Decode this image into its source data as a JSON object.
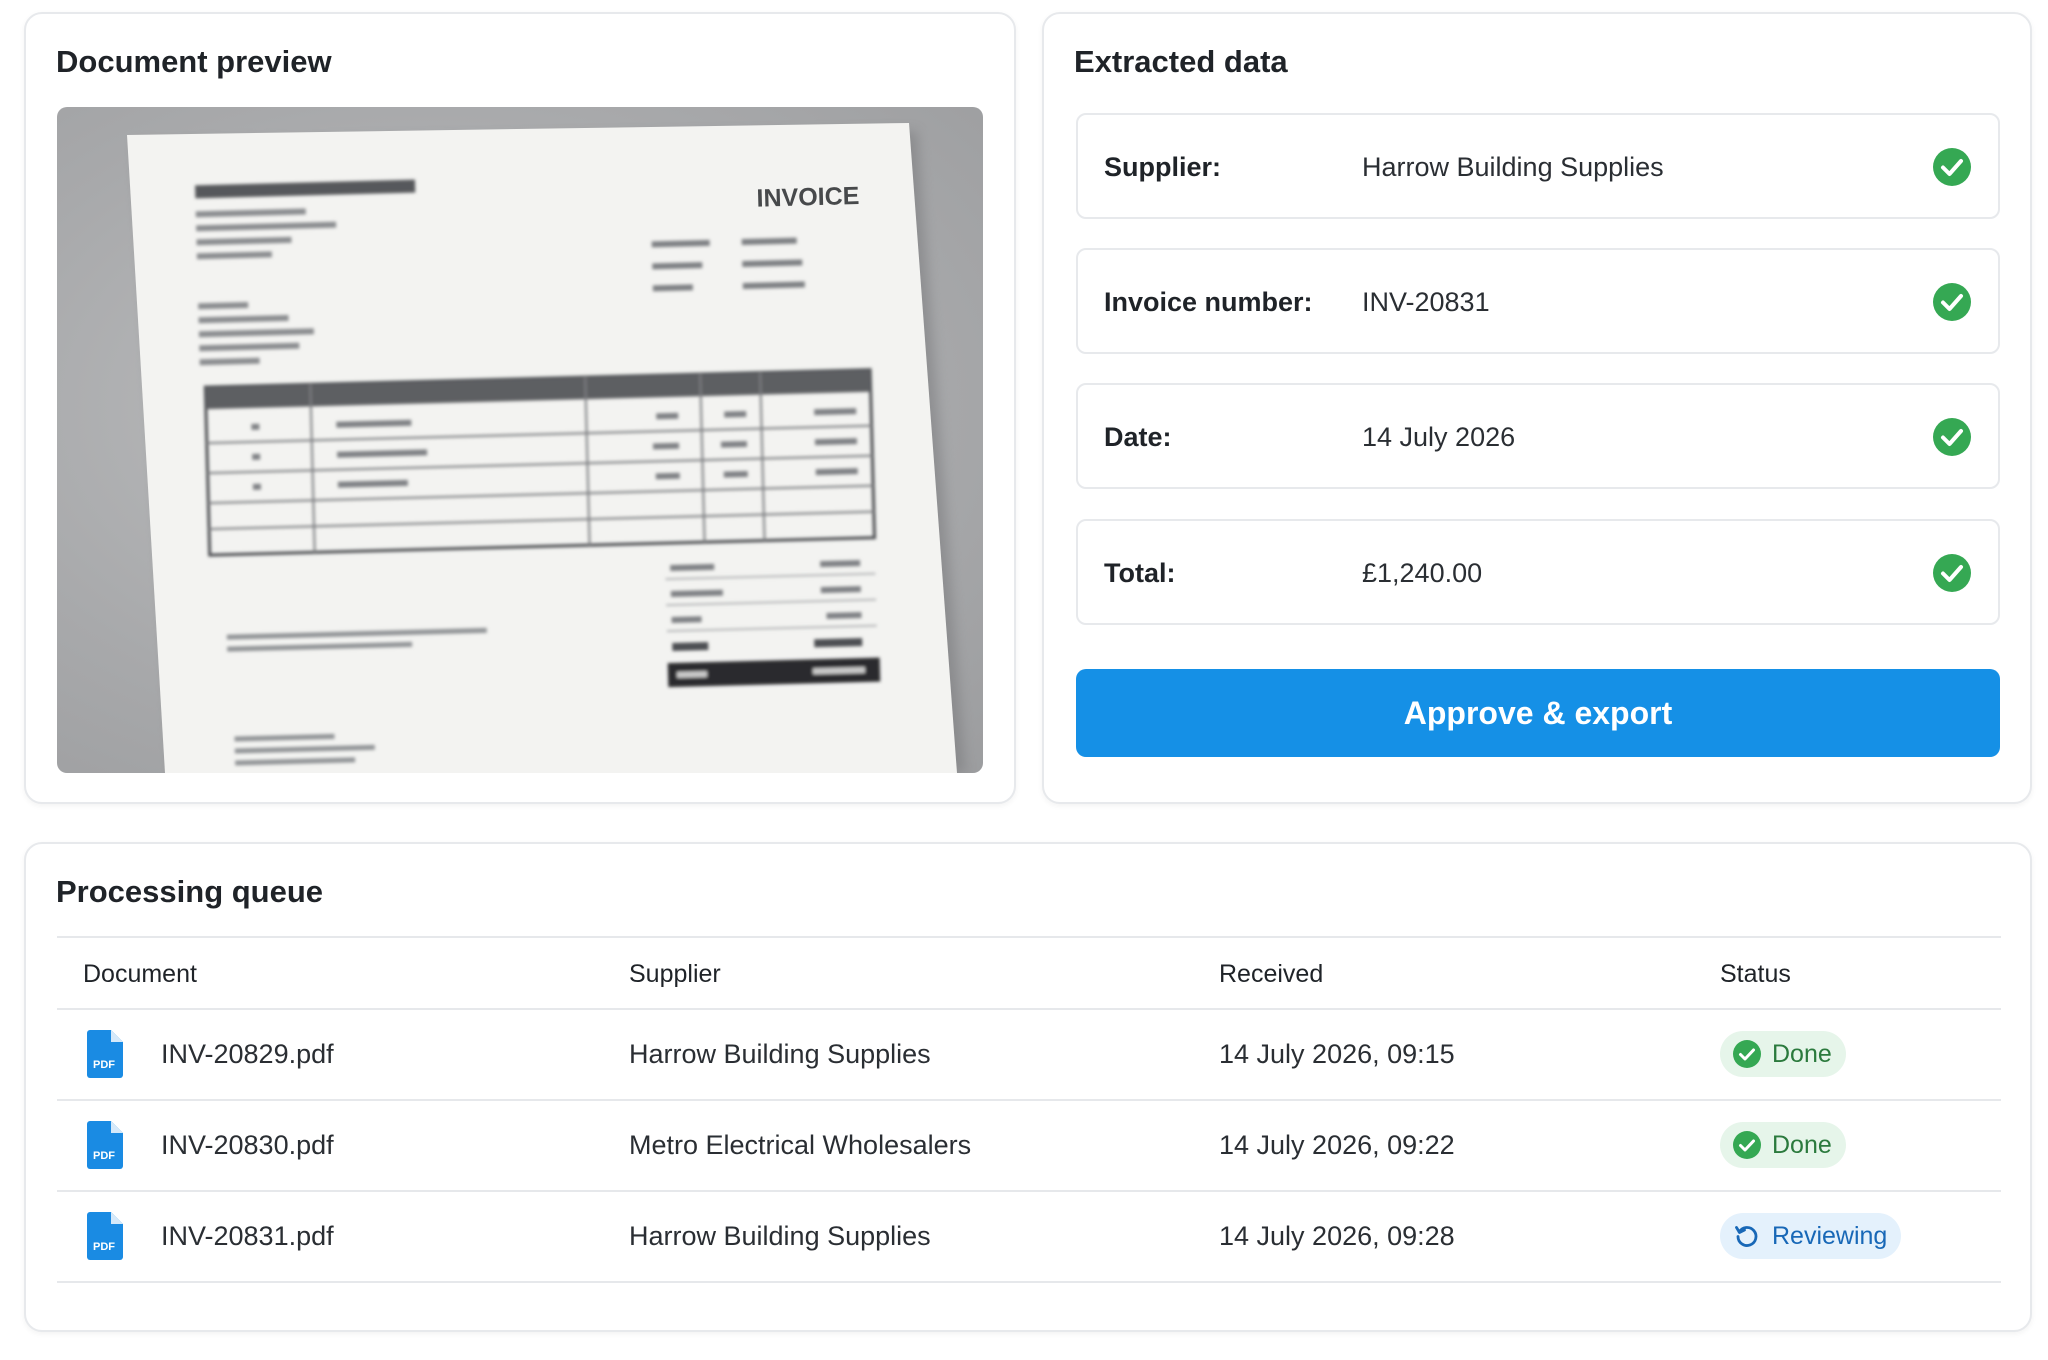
{
  "preview": {
    "title": "Document preview",
    "invoice_heading": "INVOICE"
  },
  "extracted": {
    "title": "Extracted data",
    "fields": [
      {
        "label": "Supplier:",
        "value": "Harrow Building Supplies",
        "verified": true
      },
      {
        "label": "Invoice number:",
        "value": "INV-20831",
        "verified": true
      },
      {
        "label": "Date:",
        "value": "14 July 2026",
        "verified": true
      },
      {
        "label": "Total:",
        "value": "£1,240.00",
        "verified": true
      }
    ],
    "approve_label": "Approve & export"
  },
  "queue": {
    "title": "Processing queue",
    "columns": [
      "Document",
      "Supplier",
      "Received",
      "Status"
    ],
    "rows": [
      {
        "document": "INV-20829.pdf",
        "supplier": "Harrow Building Supplies",
        "received": "14 July 2026, 09:15",
        "status": "Done",
        "status_icon": "check-circle-icon"
      },
      {
        "document": "INV-20830.pdf",
        "supplier": "Metro Electrical Wholesalers",
        "received": "14 July 2026, 09:22",
        "status": "Done",
        "status_icon": "check-circle-icon"
      },
      {
        "document": "INV-20831.pdf",
        "supplier": "Harrow Building Supplies",
        "received": "14 July 2026, 09:28",
        "status": "Reviewing",
        "status_icon": "refresh-icon"
      }
    ],
    "file_icon": "pdf-file-icon",
    "pdf_icon_label": "PDF"
  },
  "colors": {
    "accent": "#1590e6",
    "success": "#35a853",
    "done_bg": "#e6f5ea",
    "review_bg": "#e4f1fc",
    "review_fg": "#1868b7"
  }
}
